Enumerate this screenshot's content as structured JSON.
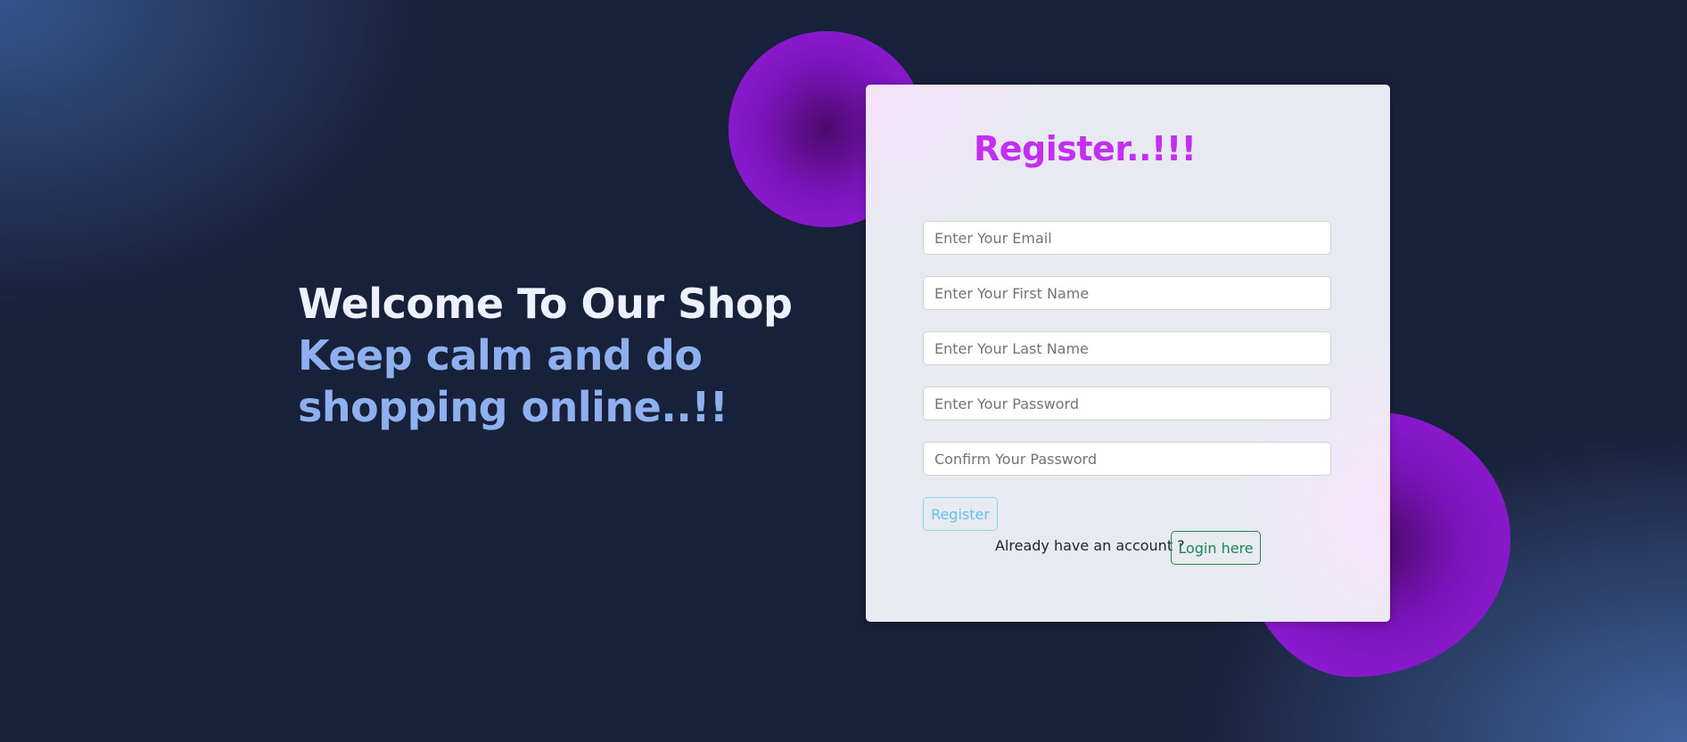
{
  "hero": {
    "title": "Welcome To Our Shop",
    "subtitle_line1": "Keep calm and do",
    "subtitle_line2": "shopping online..!!"
  },
  "register_form": {
    "title": "Register..!!!",
    "fields": {
      "email_placeholder": "Enter Your Email",
      "first_name_placeholder": "Enter Your First Name",
      "last_name_placeholder": "Enter Your Last Name",
      "password_placeholder": "Enter Your Password",
      "confirm_password_placeholder": "Confirm Your Password"
    },
    "register_button": "Register",
    "already_account_text": "Already have an account ?",
    "login_button": "Login here"
  },
  "colors": {
    "accent_title": "#c42ef0",
    "blob_purple": "#9b1ee6",
    "hero_subtitle": "#8fb0ee",
    "register_button": "#5ec4e6",
    "login_button": "#198754"
  }
}
